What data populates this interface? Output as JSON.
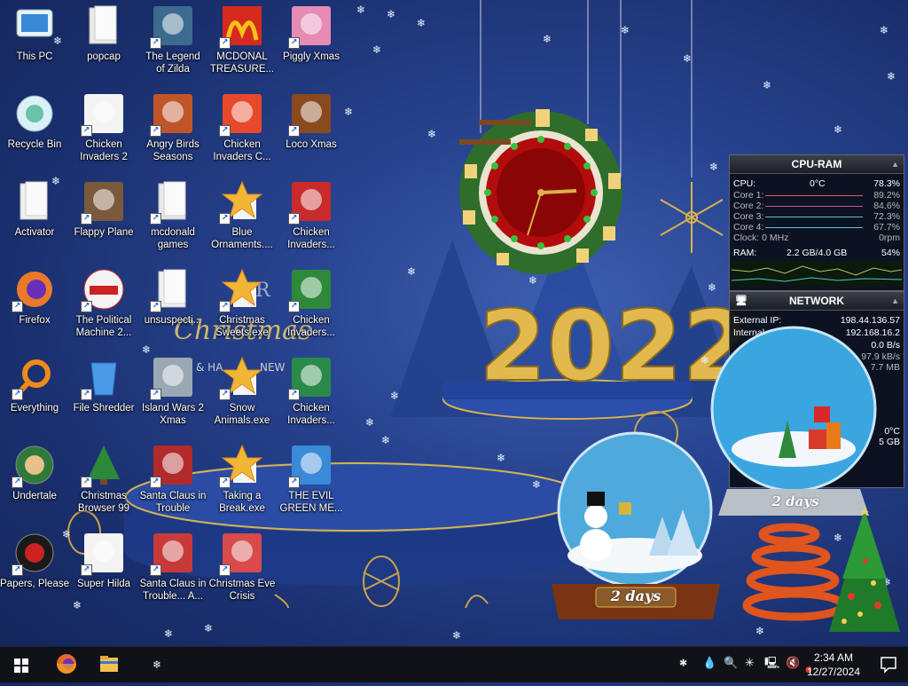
{
  "desktop": {
    "icons": [
      {
        "label": "This PC"
      },
      {
        "label": "popcap"
      },
      {
        "label": "The Legend\nof Zilda"
      },
      {
        "label": "MCDONAL\nTREASURE..."
      },
      {
        "label": "Piggly Xmas"
      },
      {
        "label": "Recycle Bin"
      },
      {
        "label": "Chicken\nInvaders 2"
      },
      {
        "label": "Angry Birds\nSeasons"
      },
      {
        "label": "Chicken\nInvaders C..."
      },
      {
        "label": "Loco Xmas"
      },
      {
        "label": "Activator"
      },
      {
        "label": "Flappy Plane"
      },
      {
        "label": "mcdonald\ngames"
      },
      {
        "label": "Blue\nOrnaments...."
      },
      {
        "label": "Chicken\nInvaders..."
      },
      {
        "label": "Firefox"
      },
      {
        "label": "The Political\nMachine 2..."
      },
      {
        "label": "unsuspecti..."
      },
      {
        "label": "Christmas\nSweets.exe"
      },
      {
        "label": "Chicken\nInvaders..."
      },
      {
        "label": "Everything"
      },
      {
        "label": "File Shredder"
      },
      {
        "label": "Island Wars 2\nXmas"
      },
      {
        "label": "Snow\nAnimals.exe"
      },
      {
        "label": "Chicken\nInvaders..."
      },
      {
        "label": "Undertale"
      },
      {
        "label": "Christmas\nBrowser 99"
      },
      {
        "label": "Santa Claus in\nTrouble"
      },
      {
        "label": "Taking a\nBreak.exe"
      },
      {
        "label": "THE EVIL\nGREEN ME..."
      },
      {
        "label": "Papers, Please"
      },
      {
        "label": "Super Hilda"
      },
      {
        "label": "Santa Claus in\nTrouble... A..."
      },
      {
        "label": "Christmas Eve\nCrisis"
      }
    ]
  },
  "wallpaper": {
    "year": "2022",
    "script_text": "Christmas",
    "partial_text_1": "ER",
    "partial_text_2": "& HA",
    "partial_text_3": "NEW"
  },
  "cpu_gadget": {
    "title": "CPU-RAM",
    "cpu_label": "CPU:",
    "cpu_temp": "0°C",
    "cpu_value": "78.3%",
    "cores": [
      {
        "label": "Core 1:",
        "value": "89.2%"
      },
      {
        "label": "Core 2:",
        "value": "84.6%"
      },
      {
        "label": "Core 3:",
        "value": "72.3%"
      },
      {
        "label": "Core 4:",
        "value": "67.7%"
      }
    ],
    "clock_label": "Clock: 0 MHz",
    "fan_label": "0rpm",
    "ram_label": "RAM:",
    "ram_value": "2.2 GB/4.0 GB",
    "ram_percent": "54%"
  },
  "network_gadget": {
    "title": "NETWORK",
    "external_ip_label": "External IP:",
    "external_ip": "198.44.136.57",
    "internal_label": "Internal",
    "internal_ip": "192.168.16.2",
    "rate1": "0.0 B/s",
    "rate2": "97.9 kB/s",
    "rate3": "7.7 MB",
    "extra_temp": "0°C",
    "extra_size": "5 GB"
  },
  "snow_globes": [
    {
      "days": "2 days"
    },
    {
      "days": "2 days"
    }
  ],
  "taskbar": {
    "time": "2:34 AM",
    "date": "12/27/2024"
  },
  "colors": {
    "taskbar": "#101218",
    "accent_gold": "#d9b24a",
    "bar_pink": "#e2557a",
    "bar_teal": "#4ec7d6"
  }
}
